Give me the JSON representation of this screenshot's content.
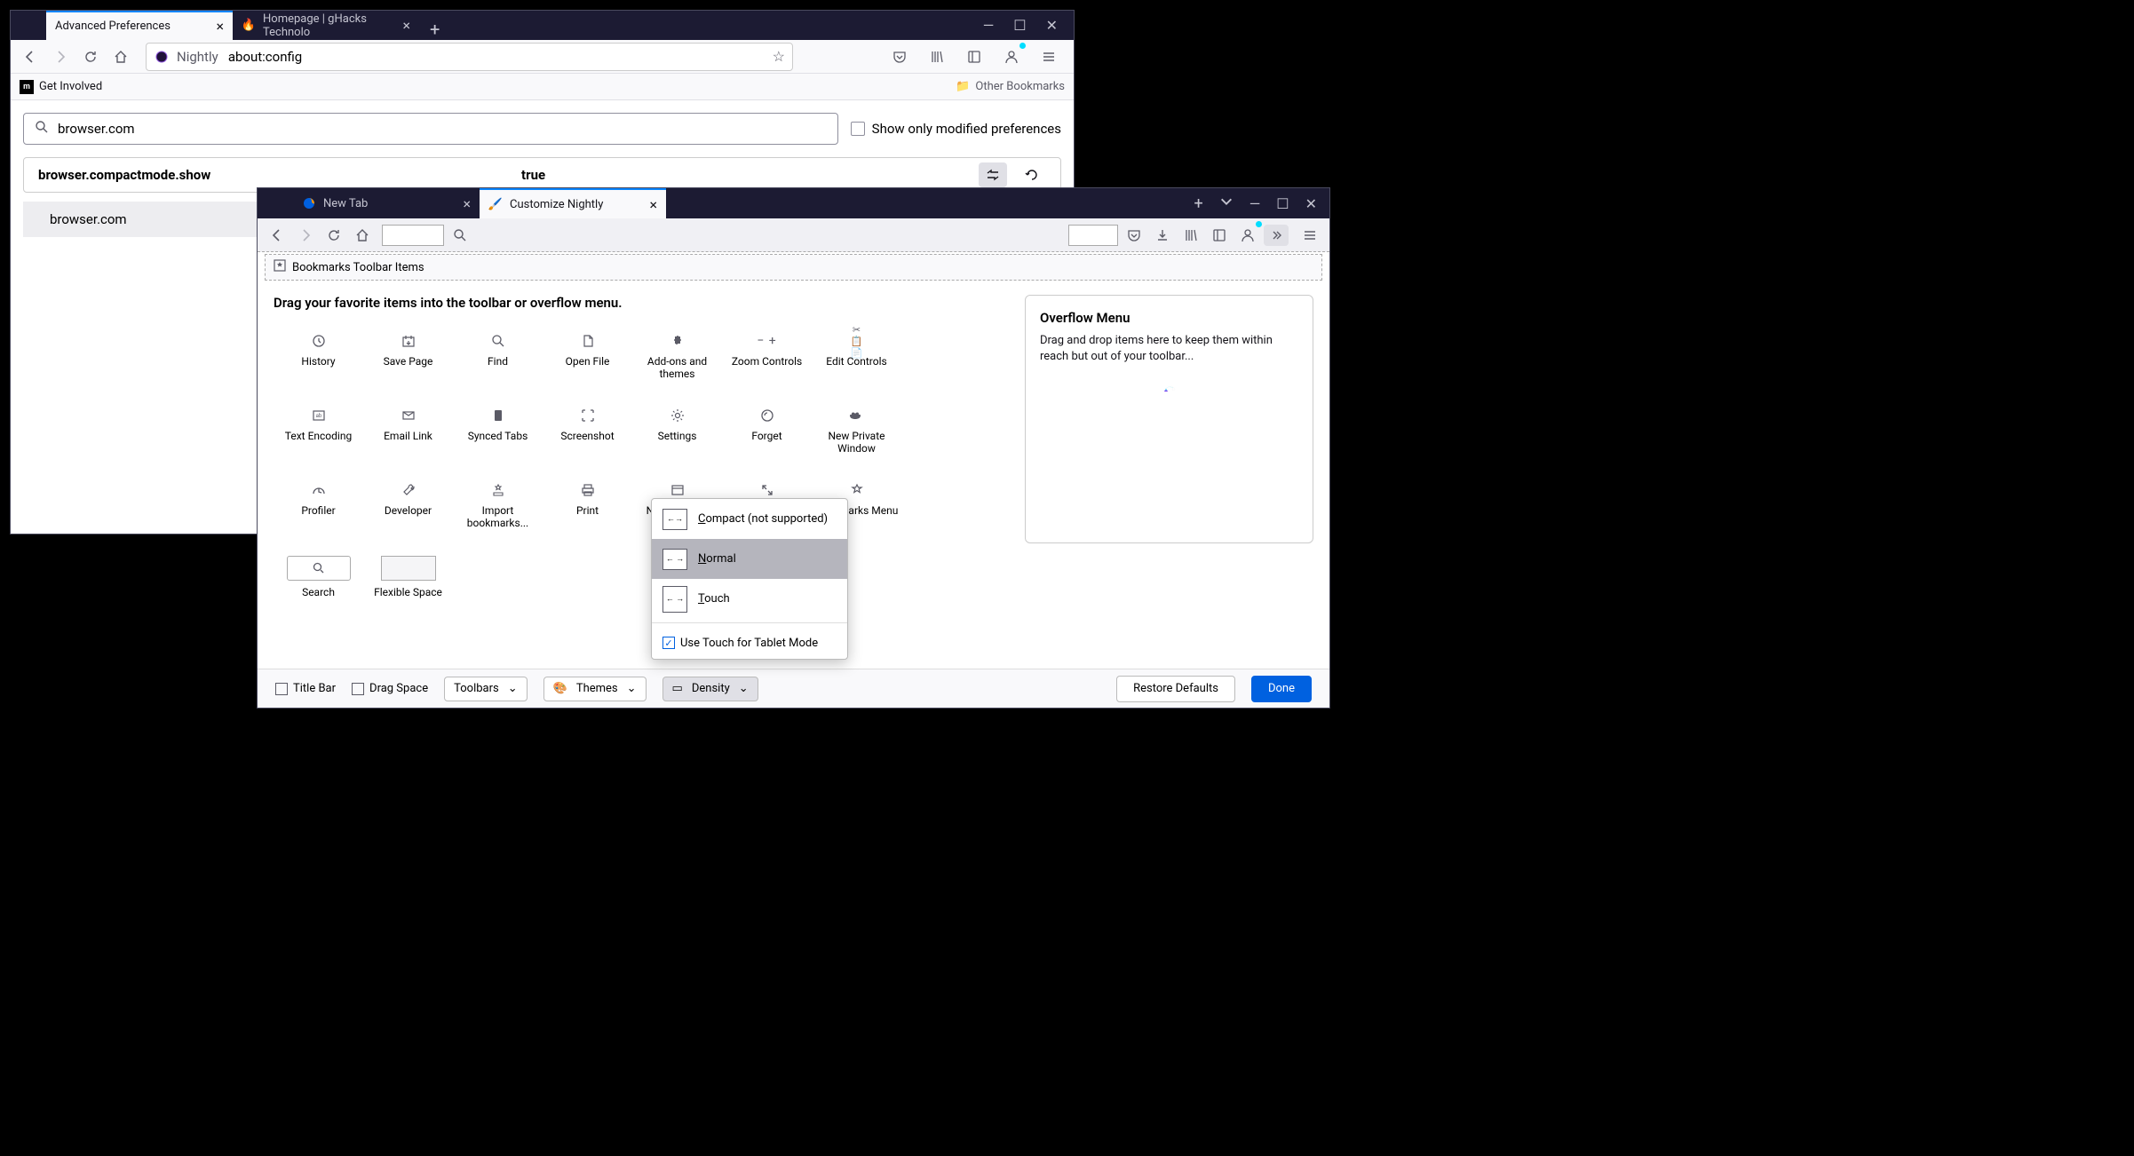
{
  "window1": {
    "tabs": [
      {
        "title": "Advanced Preferences",
        "icon": "gear"
      },
      {
        "title": "Homepage | gHacks Technolo",
        "icon": "ghacks"
      }
    ],
    "urlbar": {
      "prefix": "Nightly",
      "url": "about:config"
    },
    "bookmarks": {
      "left": "Get Involved",
      "right": "Other Bookmarks"
    },
    "search": {
      "value": "browser.com",
      "checkbox_label": "Show only modified preferences"
    },
    "pref": {
      "name": "browser.compactmode.show",
      "value": "true"
    },
    "row2": "browser.com"
  },
  "window2": {
    "tabs": [
      {
        "title": "New Tab",
        "icon": "firefox"
      },
      {
        "title": "Customize Nightly",
        "icon": "brush"
      }
    ],
    "bookbar": "Bookmarks Toolbar Items",
    "heading": "Drag your favorite items into the toolbar or overflow menu.",
    "items": [
      "History",
      "Save Page",
      "Find",
      "Open File",
      "Add-ons and themes",
      "Zoom Controls",
      "Edit Controls",
      "Text Encoding",
      "Email Link",
      "Synced Tabs",
      "Screenshot",
      "Settings",
      "Forget",
      "New Private Window",
      "Profiler",
      "Developer",
      "Import bookmarks...",
      "Print",
      "New Window",
      "Full Screen",
      "Bookmarks Menu",
      "Search",
      "Flexible Space"
    ],
    "overflow": {
      "title": "Overflow Menu",
      "desc": "Drag and drop items here to keep them within reach but out of your toolbar..."
    },
    "density": {
      "options": [
        "Compact (not supported)",
        "Normal",
        "Touch"
      ],
      "checkbox": "Use Touch for Tablet Mode"
    },
    "footer": {
      "titlebar": "Title Bar",
      "dragspace": "Drag Space",
      "toolbars": "Toolbars",
      "themes": "Themes",
      "density": "Density",
      "restore": "Restore Defaults",
      "done": "Done"
    }
  }
}
